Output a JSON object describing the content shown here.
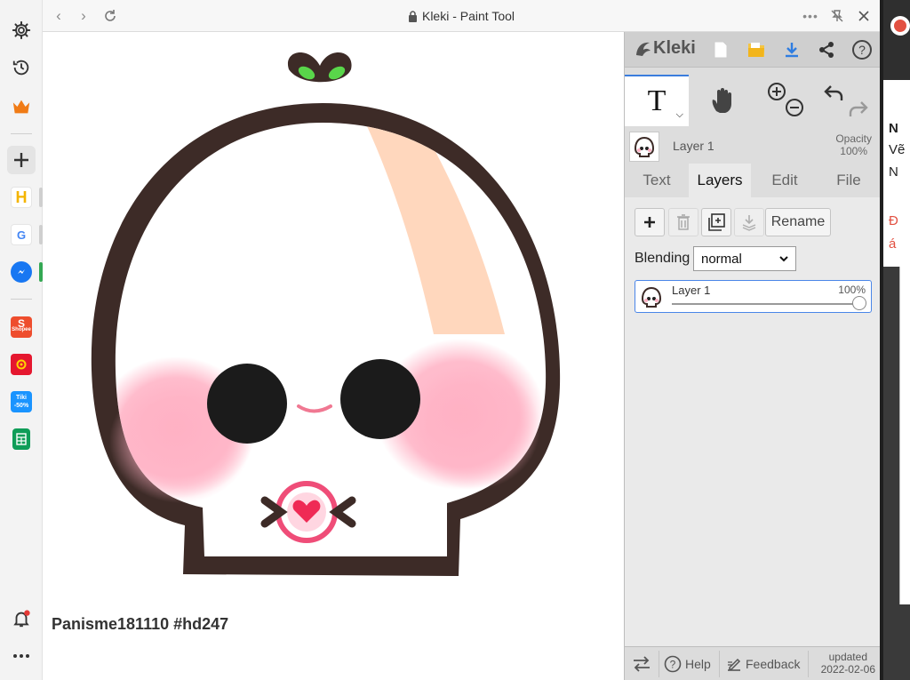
{
  "window": {
    "title": "Kleki - Paint Tool"
  },
  "sidebar": {
    "items": [
      {
        "name": "settings-icon"
      },
      {
        "name": "history-icon"
      },
      {
        "name": "crown-icon"
      },
      {
        "name": "add-icon"
      },
      {
        "name": "h-app-icon",
        "letter": "H",
        "color": "#f4b400"
      },
      {
        "name": "google-icon",
        "letter": "G",
        "color": "#4285f4"
      },
      {
        "name": "messenger-icon",
        "color": "#1877f2"
      },
      {
        "name": "shopee-icon",
        "label": "Shopee",
        "color": "#ee4d2d"
      },
      {
        "name": "lazada-icon",
        "color": "#e5172f"
      },
      {
        "name": "tiki-icon",
        "label": "Tiki",
        "badge": "-50%",
        "color": "#1a94ff"
      },
      {
        "name": "sheets-icon",
        "color": "#0f9d58"
      },
      {
        "name": "notifications-icon"
      },
      {
        "name": "more-icon"
      }
    ]
  },
  "canvas": {
    "caption": "Panisme181110 #hd247"
  },
  "kleki": {
    "logo": "Kleki",
    "active_tool": "T",
    "layer_info": {
      "name": "Layer 1",
      "opacity_label": "Opacity",
      "opacity_value": "100%"
    },
    "tabs": [
      {
        "label": "Text",
        "active": false
      },
      {
        "label": "Layers",
        "active": true
      },
      {
        "label": "Edit",
        "active": false
      },
      {
        "label": "File",
        "active": false
      }
    ],
    "layers": {
      "rename_label": "Rename",
      "blending_label": "Blending",
      "blending_value": "normal",
      "list": [
        {
          "name": "Layer 1",
          "opacity": "100%",
          "opacity_fraction": 1.0
        }
      ]
    },
    "footer": {
      "help_label": "Help",
      "feedback_label": "Feedback",
      "updated_label": "updated",
      "updated_date": "2022-02-06"
    }
  },
  "right_strip": {
    "lines": [
      "N",
      "Vẽ",
      "N",
      "Đ",
      "á"
    ]
  }
}
